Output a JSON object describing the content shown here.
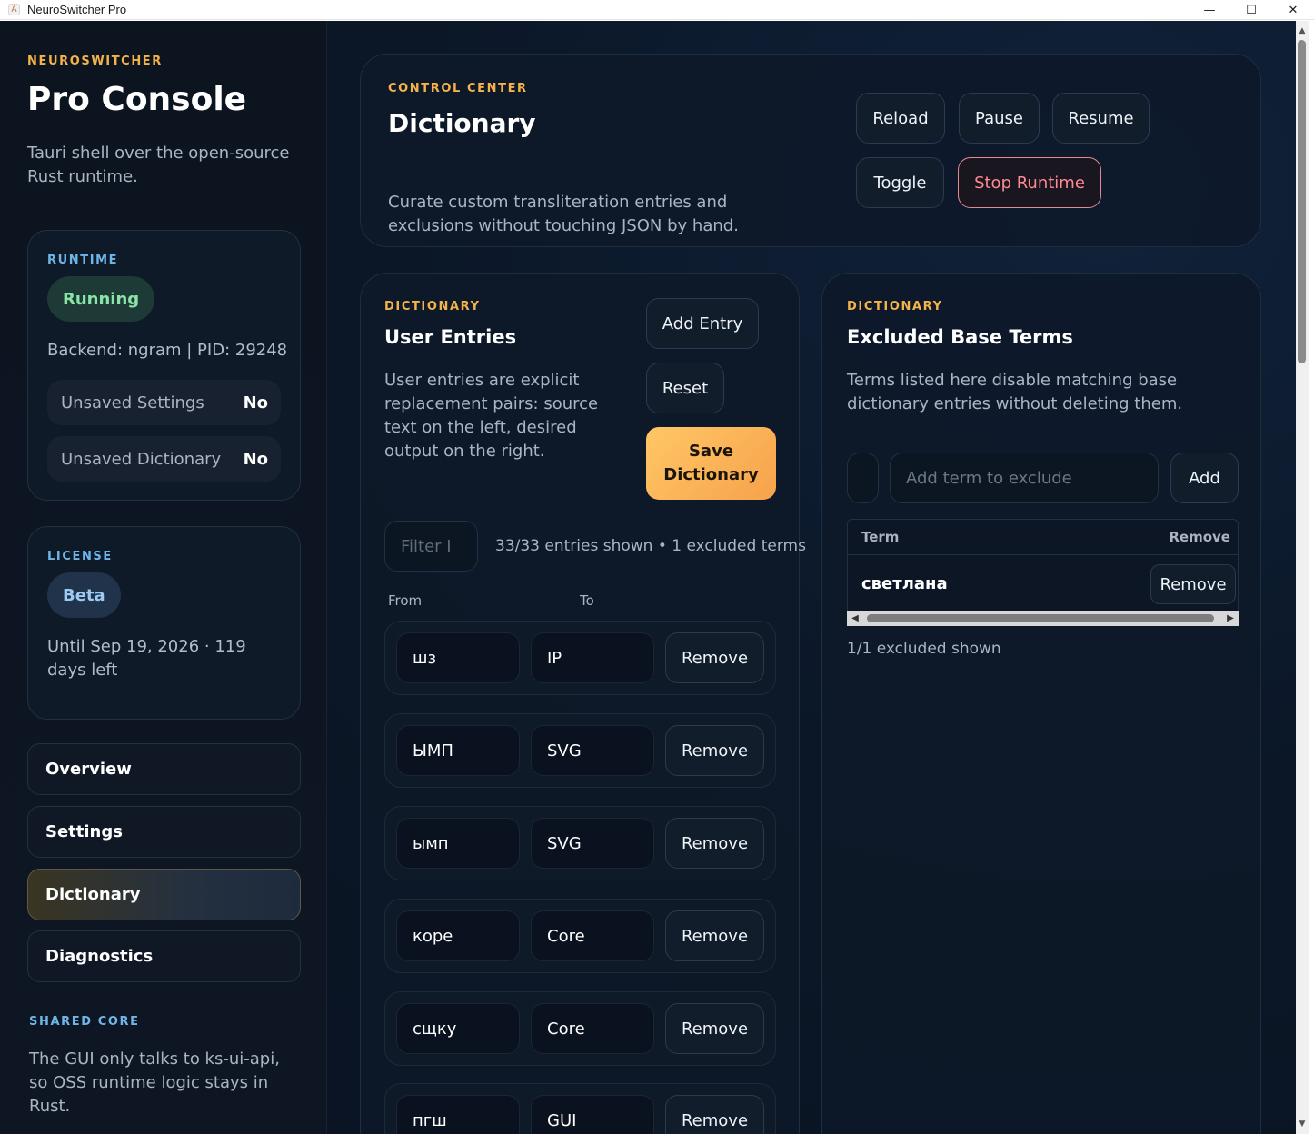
{
  "window": {
    "title": "NeuroSwitcher Pro",
    "controls": {
      "minimize": "—",
      "maximize": "☐",
      "close": "✕"
    }
  },
  "sidebar": {
    "brand_eyebrow": "NEUROSWITCHER",
    "brand_title": "Pro Console",
    "brand_subtitle": "Tauri shell over the open-source Rust runtime.",
    "runtime": {
      "eyebrow": "RUNTIME",
      "status": "Running",
      "backend_line": "Backend: ngram | PID: 29248",
      "unsaved_settings_label": "Unsaved Settings",
      "unsaved_settings_value": "No",
      "unsaved_dictionary_label": "Unsaved Dictionary",
      "unsaved_dictionary_value": "No"
    },
    "license": {
      "eyebrow": "LICENSE",
      "tier": "Beta",
      "validity": "Until Sep 19, 2026 · 119 days left"
    },
    "nav": {
      "overview": "Overview",
      "settings": "Settings",
      "dictionary": "Dictionary",
      "diagnostics": "Diagnostics",
      "active": "Dictionary"
    },
    "shared_core": {
      "eyebrow": "SHARED CORE",
      "text": "The GUI only talks to ks-ui-api, so OSS runtime logic stays in Rust."
    }
  },
  "hero": {
    "eyebrow": "CONTROL CENTER",
    "title": "Dictionary",
    "description": "Curate custom transliteration entries and exclusions without touching JSON by hand.",
    "buttons": {
      "reload": "Reload",
      "pause": "Pause",
      "resume": "Resume",
      "toggle": "Toggle",
      "stop": "Stop Runtime"
    }
  },
  "user_entries": {
    "eyebrow": "DICTIONARY",
    "title": "User Entries",
    "description": "User entries are explicit replacement pairs: source text on the left, desired output on the right.",
    "add_entry": "Add Entry",
    "reset": "Reset",
    "save": "Save Dictionary",
    "filter_placeholder": "Filter I",
    "shown_meta": "33/33 entries shown • 1 excluded terms",
    "col_from": "From",
    "col_to": "To",
    "remove_label": "Remove",
    "rows": [
      {
        "from": "шз",
        "to": "IP"
      },
      {
        "from": "ЫМП",
        "to": "SVG"
      },
      {
        "from": "ымп",
        "to": "SVG"
      },
      {
        "from": "коре",
        "to": "Core"
      },
      {
        "from": "сщку",
        "to": "Core"
      },
      {
        "from": "пгш",
        "to": "GUI"
      }
    ]
  },
  "excluded": {
    "eyebrow": "DICTIONARY",
    "title": "Excluded Base Terms",
    "description": "Terms listed here disable matching base dictionary entries without deleting them.",
    "input_placeholder": "Add term to exclude",
    "add": "Add",
    "table": {
      "col_term": "Term",
      "col_remove": "Remove",
      "rows": [
        {
          "term": "светлана",
          "action": "Remove"
        }
      ]
    },
    "meta": "1/1 excluded shown"
  }
}
